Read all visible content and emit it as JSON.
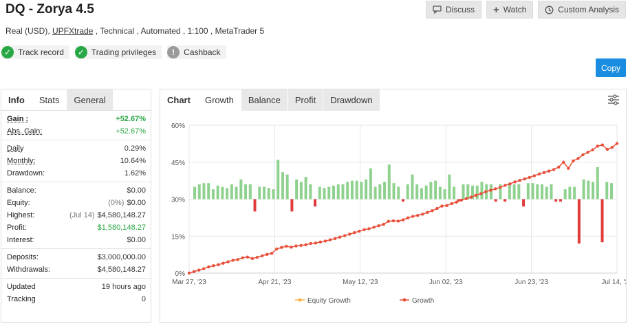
{
  "header": {
    "title": "DQ - Zorya 4.5",
    "sub_prefix": "Real (USD), ",
    "broker": "UPFXtrade",
    "sub_suffix": " , Technical , Automated , 1:100 , MetaTrader 5"
  },
  "badges": [
    {
      "label": "Track record",
      "icon": "check-icon",
      "status": "ok"
    },
    {
      "label": "Trading privileges",
      "icon": "check-icon",
      "status": "ok"
    },
    {
      "label": "Cashback",
      "icon": "exclamation-icon",
      "status": "warn"
    }
  ],
  "actions": {
    "discuss": "Discuss",
    "watch": "Watch",
    "custom_analysis": "Custom Analysis",
    "copy": "Copy"
  },
  "left_tabs": {
    "info": "Info",
    "stats": "Stats",
    "general": "General"
  },
  "stats": {
    "gain_label": "Gain :",
    "gain_value": "+52.67%",
    "abs_gain_label": "Abs. Gain:",
    "abs_gain_value": "+52.67%",
    "daily_label": "Daily",
    "daily_value": "0.29%",
    "monthly_label": "Monthly:",
    "monthly_value": "10.64%",
    "drawdown_label": "Drawdown:",
    "drawdown_value": "1.62%",
    "balance_label": "Balance:",
    "balance_value": "$0.00",
    "equity_label": "Equity:",
    "equity_note": "(0%)",
    "equity_value": "$0.00",
    "highest_label": "Highest:",
    "highest_note": "(Jul 14)",
    "highest_value": "$4,580,148.27",
    "profit_label": "Profit:",
    "profit_value": "$1,580,148.27",
    "interest_label": "Interest:",
    "interest_value": "$0.00",
    "deposits_label": "Deposits:",
    "deposits_value": "$3,000,000.00",
    "withdrawals_label": "Withdrawals:",
    "withdrawals_value": "$4,580,148.27",
    "updated_label": "Updated",
    "updated_value": "19 hours ago",
    "tracking_label": "Tracking",
    "tracking_value": "0"
  },
  "chart_tabs": {
    "chart": "Chart",
    "growth": "Growth",
    "balance": "Balance",
    "profit": "Profit",
    "drawdown": "Drawdown"
  },
  "colors": {
    "growth_line": "#e8503a",
    "equity_line": "#f5b342",
    "bar_pos": "#8fd18f",
    "bar_neg": "#e03c3c",
    "accent": "#1a8de0"
  },
  "chart_data": {
    "type": "line",
    "x_tick_labels": [
      "Mar 27, '23",
      "Apr 21, '23",
      "May 12, '23",
      "Jun 02, '23",
      "Jun 23, '23",
      "Jul 14, '23"
    ],
    "y_tick_labels": [
      "0%",
      "15%",
      "30%",
      "45%",
      "60%"
    ],
    "ylim": [
      0,
      60
    ],
    "grid": true,
    "legend_position": "bottom",
    "series": [
      {
        "name": "Equity Growth",
        "values": []
      },
      {
        "name": "Growth",
        "values": [
          0,
          0.6,
          1.2,
          1.8,
          2.5,
          3.0,
          3.4,
          4.0,
          4.6,
          5.2,
          5.5,
          6.2,
          6.5,
          5.9,
          6.4,
          7.0,
          7.6,
          8.0,
          9.8,
          10.4,
          10.9,
          10.5,
          11.0,
          11.2,
          11.5,
          12.0,
          12.2,
          12.6,
          13.0,
          13.5,
          14.0,
          14.6,
          15.2,
          15.8,
          16.4,
          17.0,
          17.6,
          18.0,
          18.6,
          19.2,
          19.8,
          21.0,
          21.2,
          21.1,
          21.6,
          22.4,
          23.0,
          23.4,
          23.9,
          24.6,
          25.3,
          26.2,
          27.2,
          27.4,
          28.2,
          28.8,
          29.6,
          30.2,
          30.8,
          31.6,
          32.2,
          33.0,
          33.6,
          34.2,
          34.8,
          35.6,
          36.2,
          37.0,
          37.6,
          38.2,
          38.8,
          39.5,
          40.2,
          40.8,
          41.4,
          42.0,
          43.0,
          45.0,
          42.5,
          45.5,
          46.5,
          48.0,
          49.0,
          50.0,
          51.5,
          52.0,
          50.2,
          51.0,
          52.6
        ]
      }
    ],
    "bars": [
      5,
      6,
      6.5,
      6.5,
      4,
      5.5,
      5,
      4.5,
      6,
      5,
      8,
      6,
      6,
      -5,
      5,
      5,
      4.5,
      4,
      16,
      11,
      10,
      -5,
      8,
      7,
      9,
      6,
      -3,
      5,
      4.5,
      5,
      5.5,
      6,
      6,
      7,
      7.5,
      7.5,
      7,
      8,
      12.5,
      5,
      6,
      7,
      14,
      6.5,
      5,
      -1,
      6,
      10,
      6,
      4.5,
      5.5,
      7,
      7.5,
      5,
      4,
      10,
      5,
      -1,
      6,
      6,
      5.5,
      5.5,
      7,
      6,
      6,
      -1,
      6,
      -1,
      6.5,
      6,
      6,
      -3,
      6.5,
      6.5,
      6,
      6,
      5,
      6,
      -1,
      -1,
      4,
      5,
      5,
      -18,
      8,
      7.5,
      7,
      13,
      -17.5,
      7,
      6.5
    ]
  }
}
